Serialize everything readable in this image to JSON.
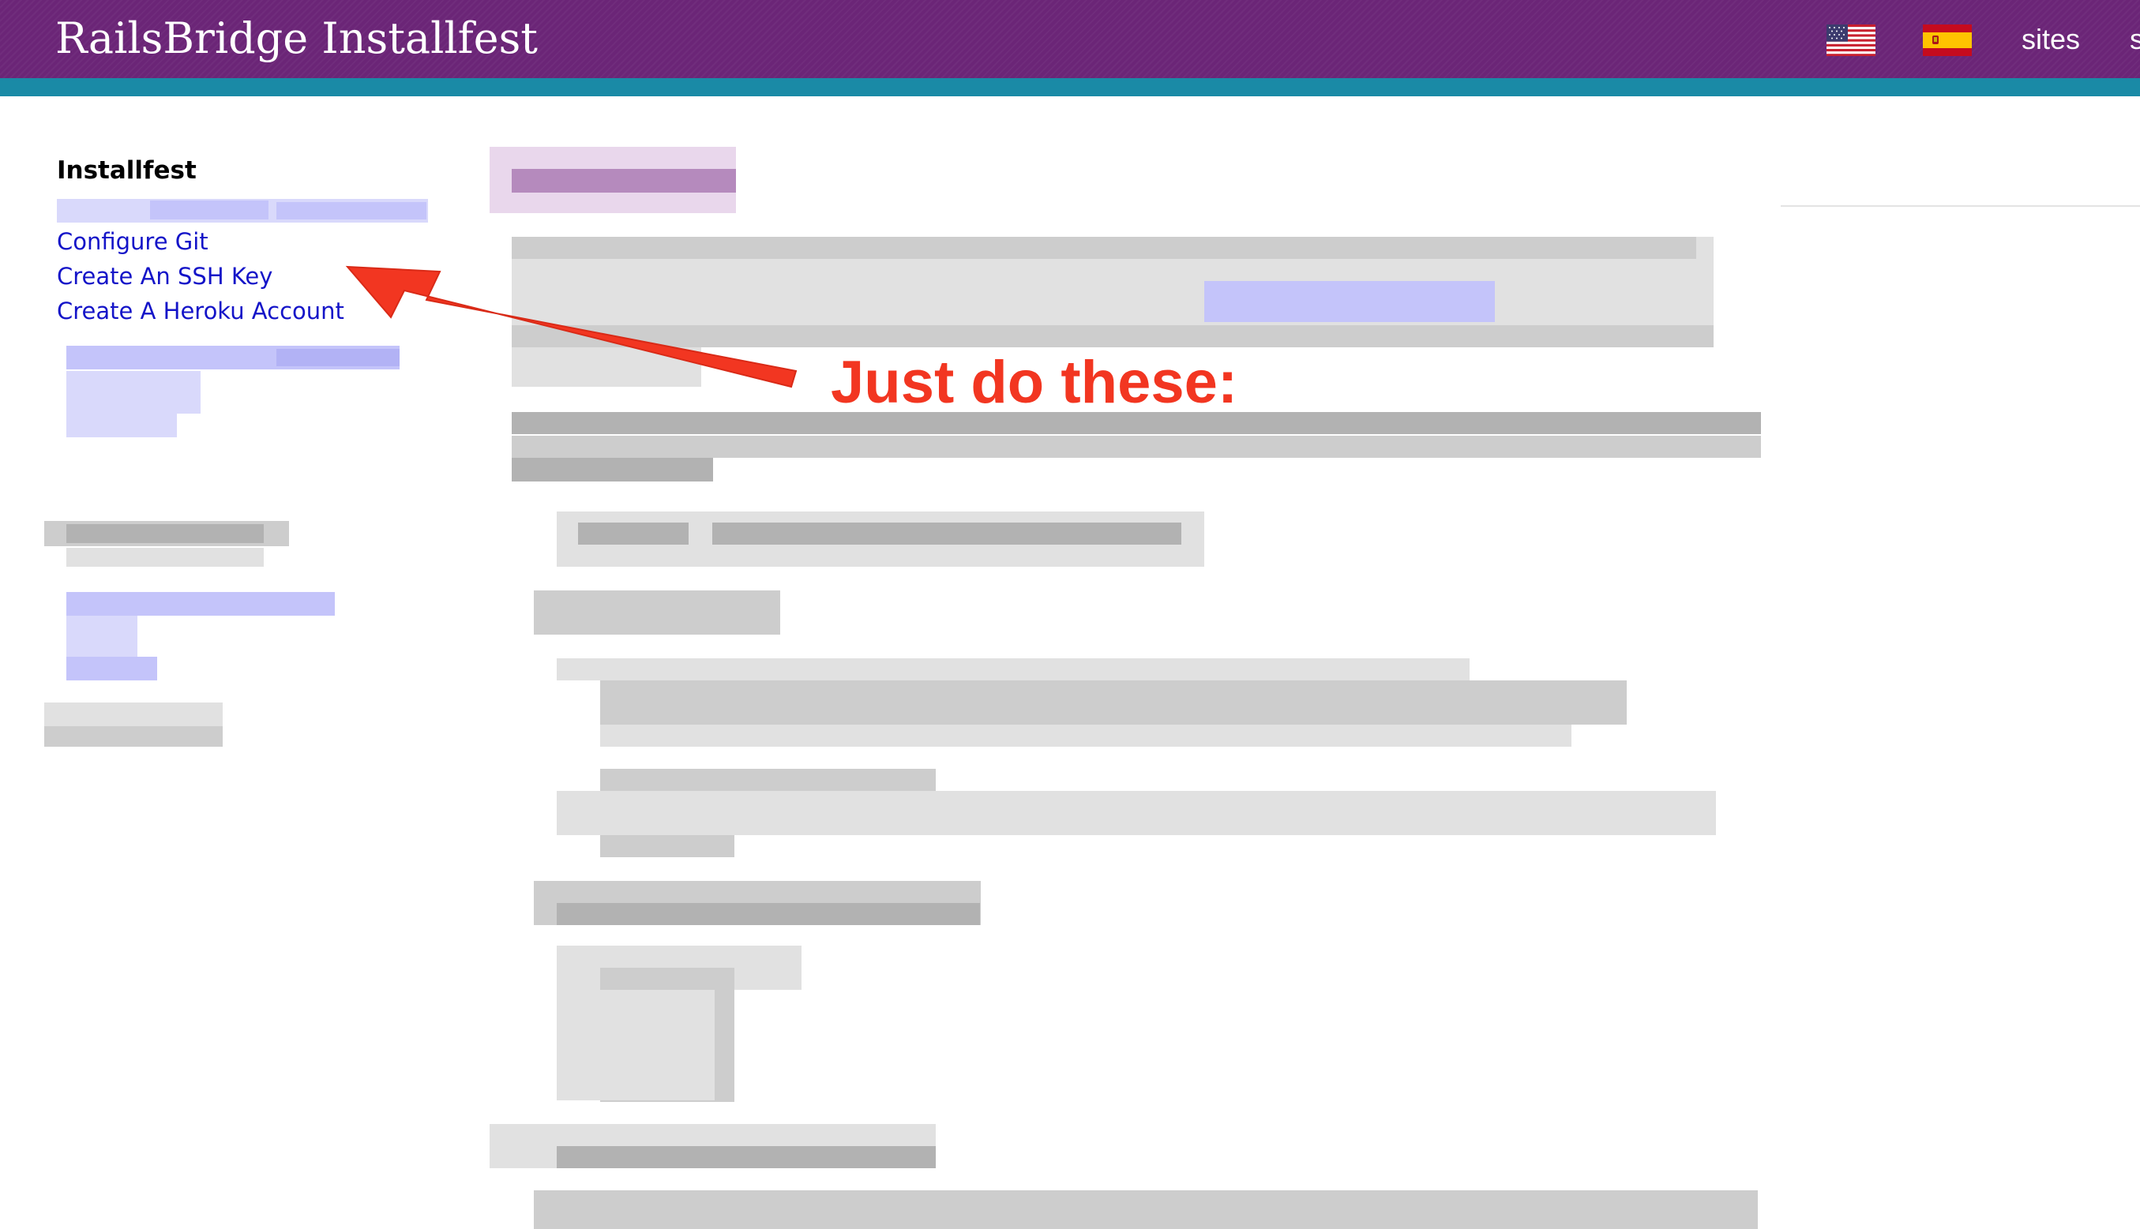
{
  "header": {
    "brand": "RailsBridge Installfest",
    "nav_sites": "sites",
    "nav_more": "s"
  },
  "sidebar": {
    "heading": "Installfest",
    "links": [
      "Configure Git",
      "Create An SSH Key",
      "Create A Heroku Account"
    ]
  },
  "annotation": {
    "text": "Just do these:",
    "color": "#f23621"
  },
  "colors": {
    "header_bg": "#6b2577",
    "header_stripe": "#1a8aa6",
    "link": "#1414c8"
  },
  "icons": [
    "us-flag-icon",
    "spain-flag-icon"
  ]
}
